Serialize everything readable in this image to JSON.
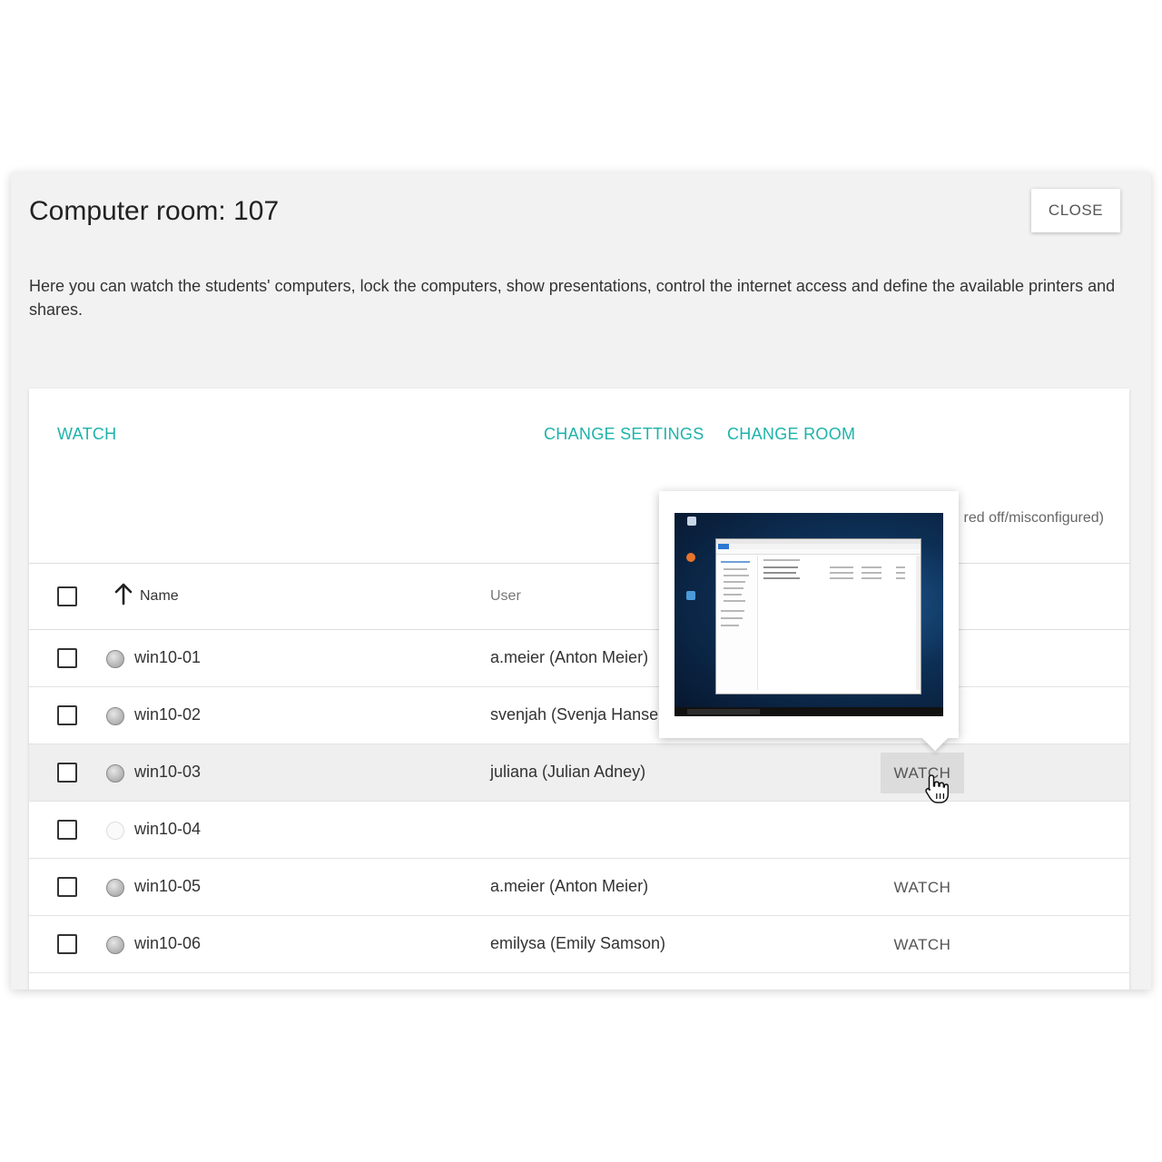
{
  "dialog": {
    "title": "Computer room: 107",
    "close_label": "CLOSE",
    "description": "Here you can watch the students' computers, lock the computers, show presentations, control the internet access and define the available printers and shares."
  },
  "toolbar": {
    "watch_label": "WATCH",
    "change_settings_label": "CHANGE SETTINGS",
    "change_room_label": "CHANGE ROOM"
  },
  "status_note": "red off/misconfigured)",
  "table": {
    "columns": {
      "name": "Name",
      "user": "User"
    },
    "rows": [
      {
        "name": "win10-01",
        "user": "a.meier (Anton Meier)",
        "status": "on",
        "action": ""
      },
      {
        "name": "win10-02",
        "user": "svenjah (Svenja Hansen)",
        "status": "on",
        "action": ""
      },
      {
        "name": "win10-03",
        "user": "juliana (Julian Adney)",
        "status": "on",
        "action": "WATCH"
      },
      {
        "name": "win10-04",
        "user": "",
        "status": "off",
        "action": ""
      },
      {
        "name": "win10-05",
        "user": "a.meier (Anton Meier)",
        "status": "on",
        "action": "WATCH"
      },
      {
        "name": "win10-06",
        "user": "emilysa (Emily Samson)",
        "status": "on",
        "action": "WATCH"
      }
    ]
  },
  "colors": {
    "accent": "#1db3aa",
    "dialog_bg": "#f2f2f2",
    "hover_row": "#efefef"
  }
}
